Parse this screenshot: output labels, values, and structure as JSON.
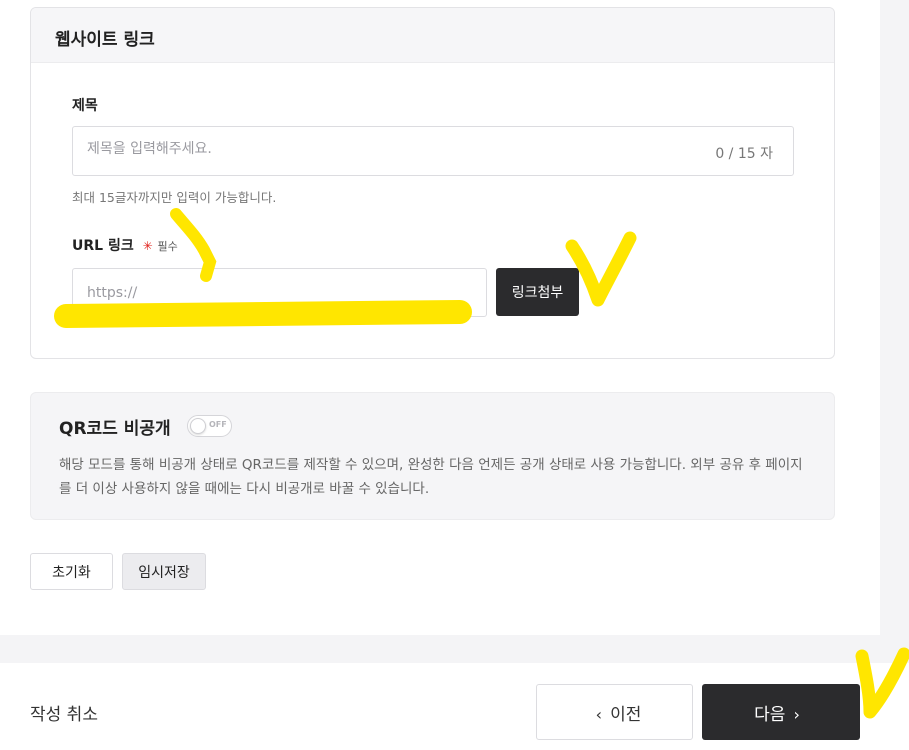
{
  "website_link": {
    "section_title": "웹사이트 링크",
    "title_field": {
      "label": "제목",
      "placeholder": "제목을 입력해주세요.",
      "value": "",
      "counter": "0 / 15 자",
      "help": "최대 15글자까지만 입력이 가능합니다."
    },
    "url_field": {
      "label": "URL 링크",
      "required_mark": "✳",
      "required_text": "필수",
      "placeholder": "https://",
      "value": "",
      "attach_label": "링크첨부"
    }
  },
  "qr_section": {
    "title": "QR코드 비공개",
    "toggle_state": "OFF",
    "description": "해당 모드를 통해 비공개 상태로 QR코드를 제작할 수 있으며, 완성한 다음 언제든 공개 상태로 사용 가능합니다. 외부 공유 후 페이지를 더 이상 사용하지 않을 때에는 다시 비공개로 바꿀 수 있습니다."
  },
  "actions": {
    "reset_label": "초기화",
    "draft_label": "임시저장"
  },
  "footer": {
    "cancel_label": "작성 취소",
    "prev_label": "이전",
    "next_label": "다음"
  },
  "icons": {
    "prev": "chevron-left-icon",
    "next": "chevron-right-icon",
    "required": "asterisk-icon"
  },
  "colors": {
    "primary_button": "#2b2b2d",
    "required": "#e0201a",
    "highlight_marker": "#ffe600"
  }
}
